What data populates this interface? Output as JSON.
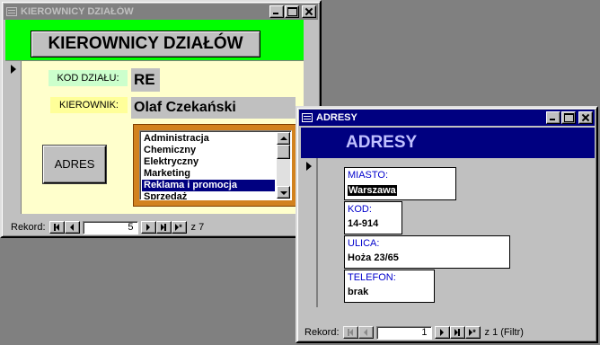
{
  "kierownicy": {
    "title": "KIEROWNICY DZIAŁÓW",
    "header_label": "KIEROWNICY DZIAŁÓW",
    "kod_label": "KOD DZIAŁU:",
    "kod_value": "RE",
    "kierownik_label": "KIEROWNIK:",
    "kierownik_value": "Olaf Czekański",
    "adres_button": "ADRES",
    "list_items": [
      "Administracja",
      "Chemiczny",
      "Elektryczny",
      "Marketing",
      "Reklama i promocja",
      "Sprzedaż"
    ],
    "selected_item": "Reklama i promocja",
    "nav": {
      "label": "Rekord:",
      "current": "5",
      "total": "z 7"
    },
    "colors": {
      "header_band": "#00ff00",
      "form_bg": "#ffffcc",
      "kod_label_bg": "#ccffcc",
      "kierownik_label_bg": "#ffff99",
      "list_frame": "#d2821e"
    }
  },
  "adresy": {
    "title": "ADRESY",
    "header_label": "ADRESY",
    "fields": [
      {
        "label": "MIASTO:",
        "value": "Warszawa"
      },
      {
        "label": "KOD:",
        "value": "14-914"
      },
      {
        "label": "ULICA:",
        "value": "Hoża 23/65"
      },
      {
        "label": "TELEFON:",
        "value": "brak"
      }
    ],
    "nav": {
      "label": "Rekord:",
      "current": "1",
      "total": "z 1 (Filtr)"
    },
    "colors": {
      "header_band": "#000080",
      "label_text": "#0000cc"
    }
  },
  "icons": [
    "form-icon",
    "minimize-icon",
    "maximize-icon",
    "close-icon",
    "first-record-icon",
    "previous-record-icon",
    "next-record-icon",
    "last-record-icon",
    "new-record-icon",
    "scroll-up-icon",
    "scroll-down-icon",
    "record-pointer-icon"
  ]
}
